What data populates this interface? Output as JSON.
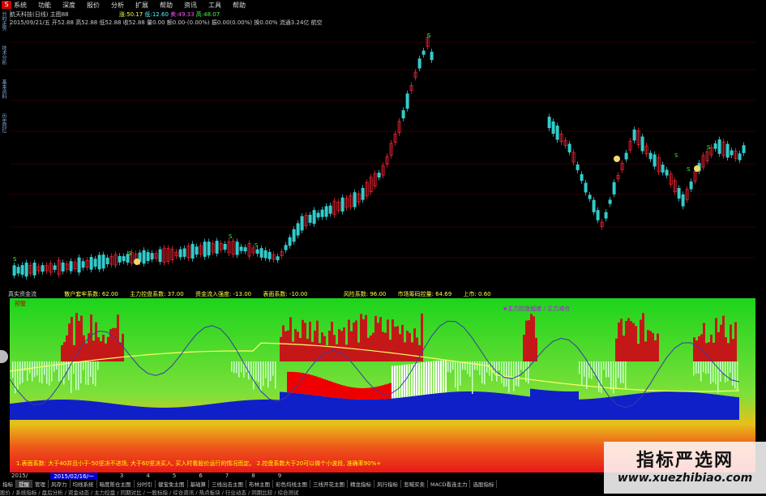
{
  "menu": [
    "系统",
    "功能",
    "深度",
    "报价",
    "分析",
    "扩展",
    "帮助",
    "资讯",
    "工具",
    "帮助"
  ],
  "sidebar_tabs": [
    "分时走势",
    "技术分析",
    "基本资料",
    "历史回忆"
  ],
  "stock_info": {
    "name": "航天科技(日线)",
    "title_suffix": "主图88",
    "line1": {
      "a": "涨:50.17",
      "b": "低:12.60",
      "c": "卖:49.33",
      "d": "高:48.07"
    },
    "line2": "2015/09/21/五 开52.88 高52.88 低52.88 收52.88 量0.00 额0.00-(0.00%) 振0.00(0.00%) 换0.00% 流通3.24亿 航空"
  },
  "price_axis_label": "60",
  "main_markers": [
    "S",
    "S",
    "S",
    "S",
    "S",
    "S",
    "S",
    "S"
  ],
  "indicator_header": {
    "title": "真实资金流",
    "items": [
      "散户套牢系数: 62.00",
      "主力控盘系数: 37.00",
      "资金流入强度: -13.00",
      "表面系数: -10.00",
      "风险系数: 96.00",
      "市场筹码控量: 64.69",
      "上市: 0.60"
    ],
    "panel_label": "预警",
    "legend": "★主力控盘程度 / 主力减仓"
  },
  "note": "1.表面系数: 大于40并且小于-50坚决不进场, 大于60坚决买入, 买入时看股价运行的情况而定。   2.控盘系数大于20可以做个小波段, 准确率90%+",
  "dates": [
    "2015/",
    "2015/02/16/一",
    "3",
    "4",
    "5",
    "6",
    "7",
    "8",
    "9"
  ],
  "selected_date": "2015/02/16/一",
  "tabs_row1": [
    "指标",
    "提醒",
    "管理",
    "风存力",
    "均线系统",
    "暗度陈仓主图",
    "分时引",
    "健宝免主图",
    "基础算",
    "三线出击主图",
    "布林主图",
    "彩色均线主图",
    "三线开花主图",
    "精龙指标",
    "风行指标",
    "悲喊买卖",
    "MACD看连主力",
    "选股指标"
  ],
  "tabs_row2": "股价 / 系统指标 / 盘后分析 / 资金动态 / 主力控盘 / 同期对比 / 一股标指 / 综合资讯 / 热点板块 / 行业动态 / 同期比较 / 综合测试",
  "watermark": {
    "title": "指标严选网",
    "url": "www.xuezhibiao.com"
  }
}
